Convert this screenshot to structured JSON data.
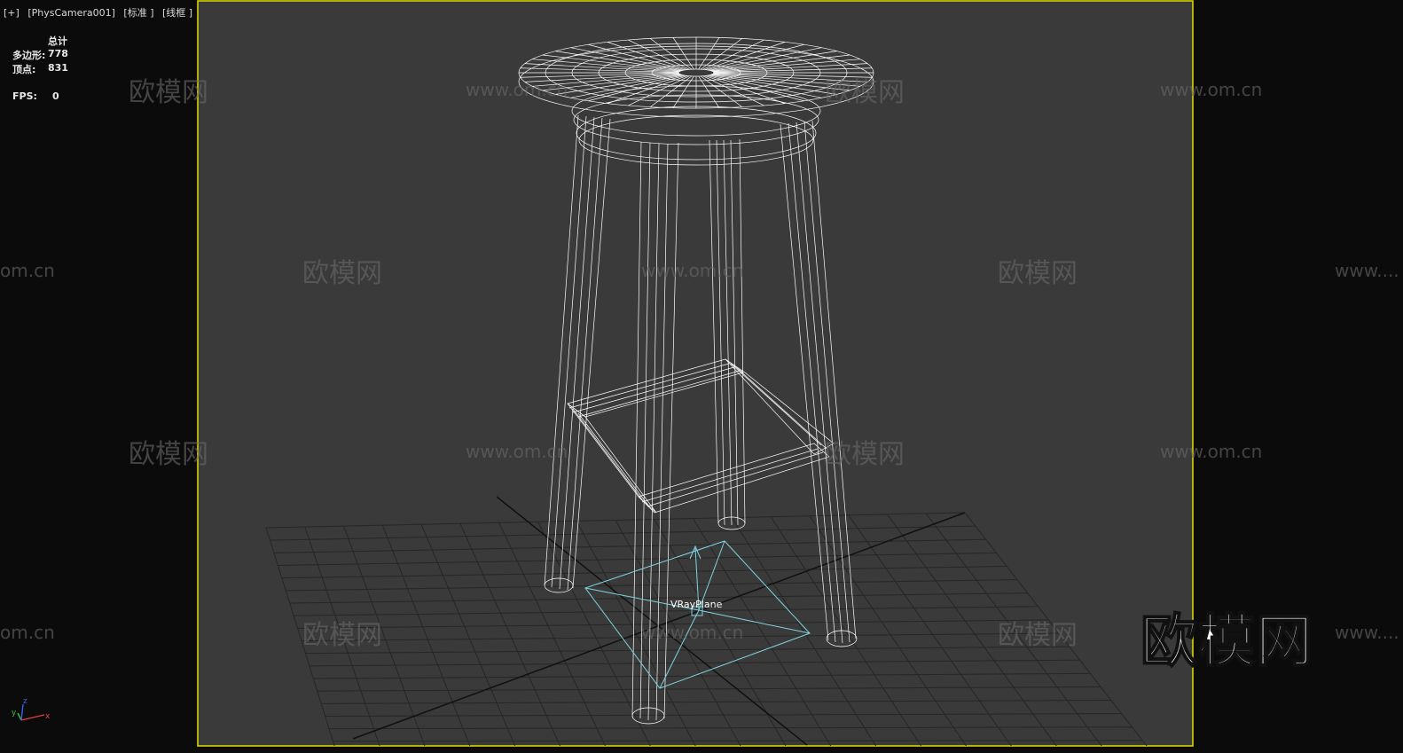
{
  "viewport": {
    "menu": [
      "[+]",
      "[PhysCamera001]",
      "[标准 ]",
      "[线框 ]"
    ],
    "border_color": "#e5e000",
    "background": "#3a3a3a"
  },
  "stats": {
    "title": "总计",
    "polygons_label": "多边形:",
    "polygons_value": "778",
    "vertices_label": "顶点:",
    "vertices_value": "831",
    "fps_label": "FPS:",
    "fps_value": "0"
  },
  "scene": {
    "object_label": "VRayPlane",
    "wireframe_color": "#ffffff",
    "helper_color": "#7fd4de"
  },
  "watermarks": {
    "logo_text": "欧模网",
    "url_text": "www.om.cn",
    "partial_url_left": "om.cn",
    "partial_url_right": "www...."
  },
  "axis": {
    "x": "x",
    "y": "y",
    "z": "z",
    "x_color": "#e04040",
    "y_color": "#40c040",
    "z_color": "#4060e0"
  }
}
